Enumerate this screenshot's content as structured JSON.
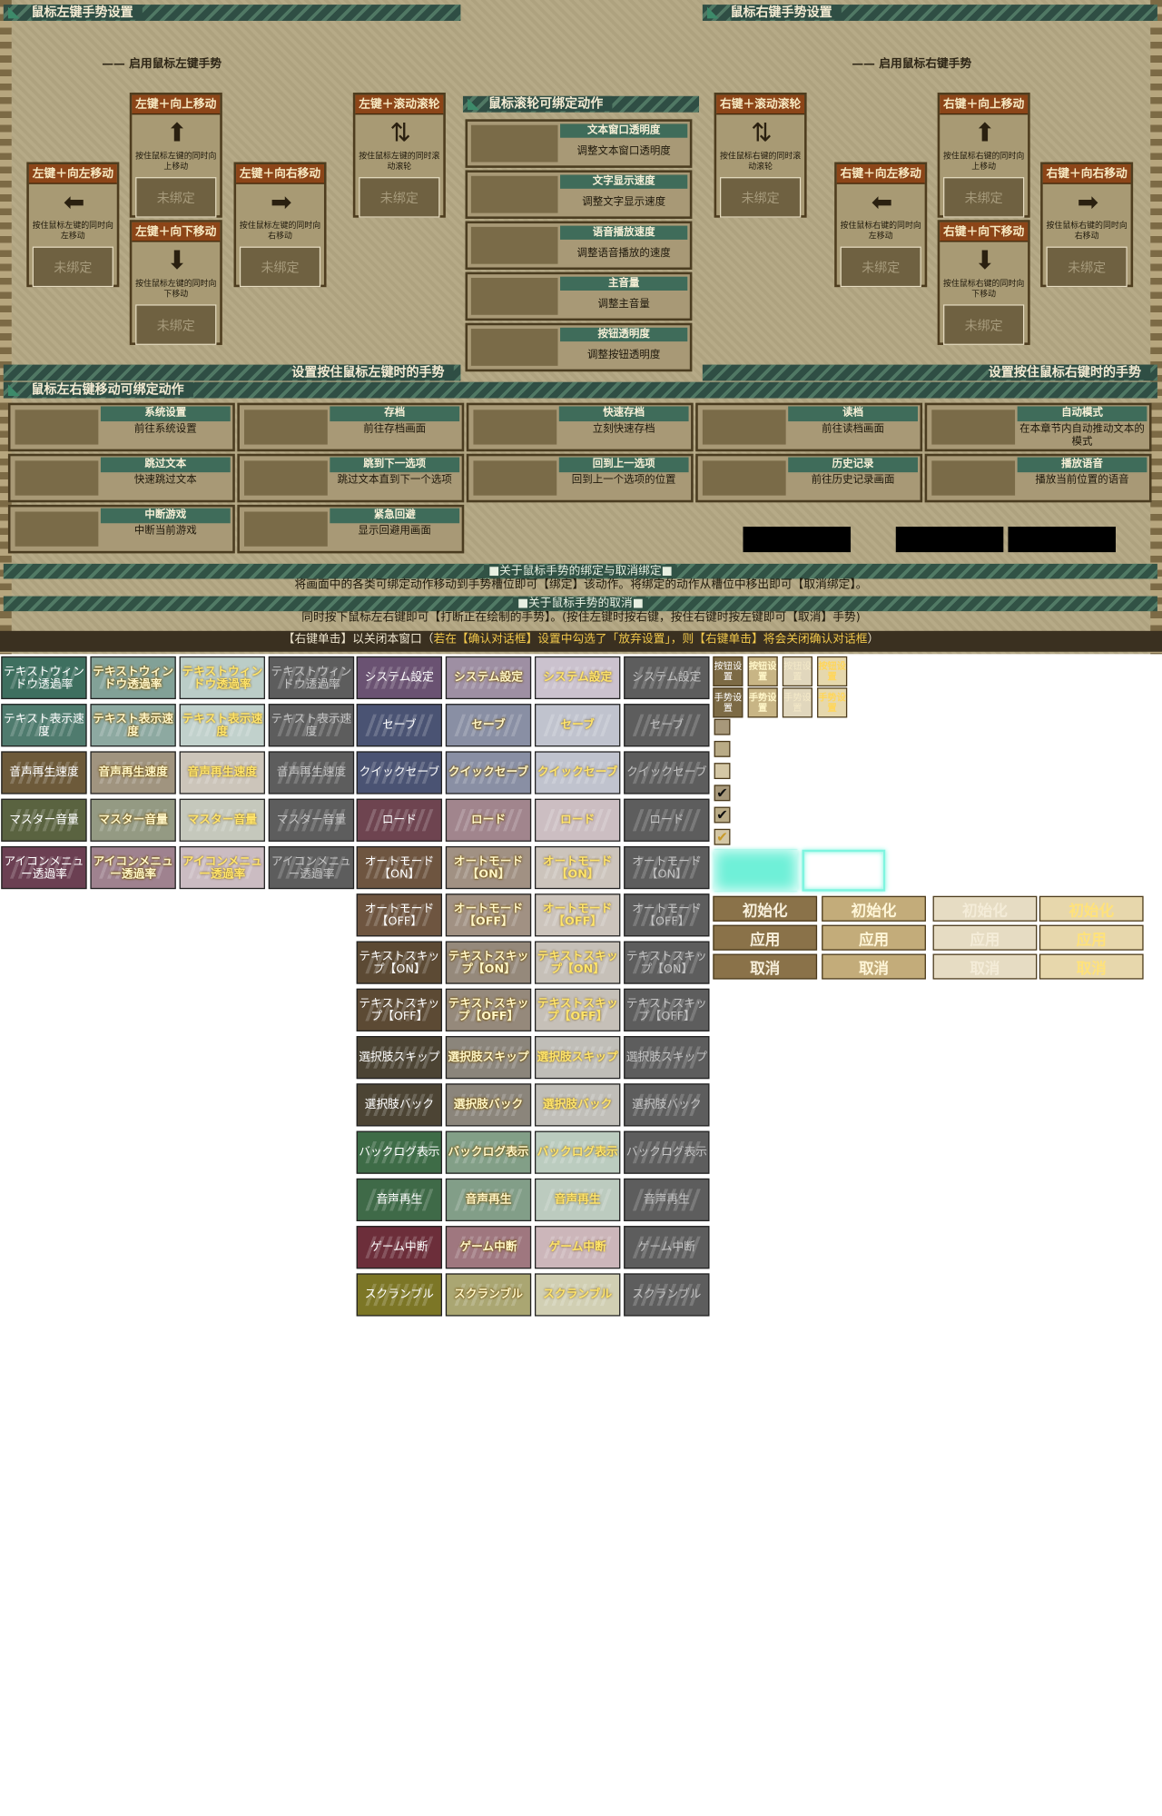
{
  "left_panel": {
    "title": "鼠标左键手势设置",
    "subtitle": "—— 启用鼠标左键手势",
    "footer": "设置按住鼠标左键时的手势",
    "cards": [
      {
        "key": "up",
        "title": "左键＋向上移动",
        "glyph": "⬆",
        "desc": "按住鼠标左键的同时向上移动",
        "slot": "未绑定"
      },
      {
        "key": "scroll",
        "title": "左键＋滚动滚轮",
        "glyph": "⇅",
        "desc": "按住鼠标左键的同时滚动滚轮",
        "slot": "未绑定"
      },
      {
        "key": "leftmove",
        "title": "左键＋向左移动",
        "glyph": "⬅",
        "desc": "按住鼠标左键的同时向左移动",
        "slot": "未绑定"
      },
      {
        "key": "rightmove",
        "title": "左键＋向右移动",
        "glyph": "➡",
        "desc": "按住鼠标左键的同时向右移动",
        "slot": "未绑定"
      },
      {
        "key": "down",
        "title": "左键＋向下移动",
        "glyph": "⬇",
        "desc": "按住鼠标左键的同时向下移动",
        "slot": "未绑定"
      }
    ]
  },
  "right_panel": {
    "title": "鼠标右键手势设置",
    "subtitle": "—— 启用鼠标右键手势",
    "footer": "设置按住鼠标右键时的手势",
    "cards": [
      {
        "key": "scroll",
        "title": "右键＋滚动滚轮",
        "glyph": "⇅",
        "desc": "按住鼠标右键的同时滚动滚轮",
        "slot": "未绑定"
      },
      {
        "key": "up",
        "title": "右键＋向上移动",
        "glyph": "⬆",
        "desc": "按住鼠标右键的同时向上移动",
        "slot": "未绑定"
      },
      {
        "key": "leftmove",
        "title": "右键＋向左移动",
        "glyph": "⬅",
        "desc": "按住鼠标右键的同时向左移动",
        "slot": "未绑定"
      },
      {
        "key": "rightmove",
        "title": "右键＋向右移动",
        "glyph": "➡",
        "desc": "按住鼠标右键的同时向右移动",
        "slot": "未绑定"
      },
      {
        "key": "down",
        "title": "右键＋向下移动",
        "glyph": "⬇",
        "desc": "按住鼠标右键的同时向下移动",
        "slot": "未绑定"
      }
    ]
  },
  "wheel_panel": {
    "title": "鼠标滚轮可绑定动作",
    "items": [
      {
        "title": "文本窗口透明度",
        "desc": "调整文本窗口透明度"
      },
      {
        "title": "文字显示速度",
        "desc": "调整文字显示速度"
      },
      {
        "title": "语音播放速度",
        "desc": "调整语音播放的速度"
      },
      {
        "title": "主音量",
        "desc": "调整主音量"
      },
      {
        "title": "按钮透明度",
        "desc": "调整按钮透明度"
      }
    ]
  },
  "move_panel": {
    "title": "鼠标左右键移动可绑定动作",
    "items": [
      {
        "title": "系统设置",
        "desc": "前往系统设置"
      },
      {
        "title": "存档",
        "desc": "前往存档画面"
      },
      {
        "title": "快速存档",
        "desc": "立刻快速存档"
      },
      {
        "title": "读档",
        "desc": "前往读档画面"
      },
      {
        "title": "自动模式",
        "desc": "在本章节内自动推动文本的模式"
      },
      {
        "title": "跳过文本",
        "desc": "快速跳过文本"
      },
      {
        "title": "跳到下一选项",
        "desc": "跳过文本直到下一个选项"
      },
      {
        "title": "回到上一选项",
        "desc": "回到上一个选项的位置"
      },
      {
        "title": "历史记录",
        "desc": "前往历史记录画面"
      },
      {
        "title": "播放语音",
        "desc": "播放当前位置的语音"
      },
      {
        "title": "中断游戏",
        "desc": "中断当前游戏"
      },
      {
        "title": "紧急回避",
        "desc": "显示回避用画面"
      }
    ]
  },
  "info": {
    "bind_header": "■关于鼠标手势的绑定与取消绑定■",
    "bind_text": "将画面中的各类可绑定动作移动到手势槽位即可【绑定】该动作。将绑定的动作从槽位中移出即可【取消绑定】。",
    "cancel_header": "■关于鼠标手势的取消■",
    "cancel_text": "同时按下鼠标左右键即可【打断正在绘制的手势】。(按住左键时按右键，按住右键时按左键即可【取消】手势)",
    "close_parts": [
      "【右键单击】以关闭本窗口（",
      "若在【确认对话框】设置中勾选了「放弃设置」，则【右键单击】将会关闭确认对话框",
      "）"
    ]
  },
  "sprites_left": [
    "テキストウィンドウ透過率",
    "テキスト表示速度",
    "音声再生速度",
    "マスター音量",
    "アイコンメニュー透過率"
  ],
  "sprites_mid": [
    "システム設定",
    "セーブ",
    "クイックセーブ",
    "ロード",
    "オートモード【ON】",
    "オートモード【OFF】",
    "テキストスキップ【ON】",
    "テキストスキップ【OFF】",
    "選択肢スキップ",
    "選択肢バック",
    "バックログ表示",
    "音声再生",
    "ゲーム中断",
    "スクランブル"
  ],
  "small_buttons": [
    "按钮设置",
    "手势设置"
  ],
  "checks": [
    "",
    "",
    "",
    "✔",
    "✔",
    "✔"
  ],
  "wide_buttons": [
    "初始化",
    "应用",
    "取消"
  ],
  "colors": {
    "panel_green": "#2f4e44",
    "card_orange": "#8c4518",
    "parchment": "#b4a783",
    "cyan_glow": "#7ff5e0"
  }
}
